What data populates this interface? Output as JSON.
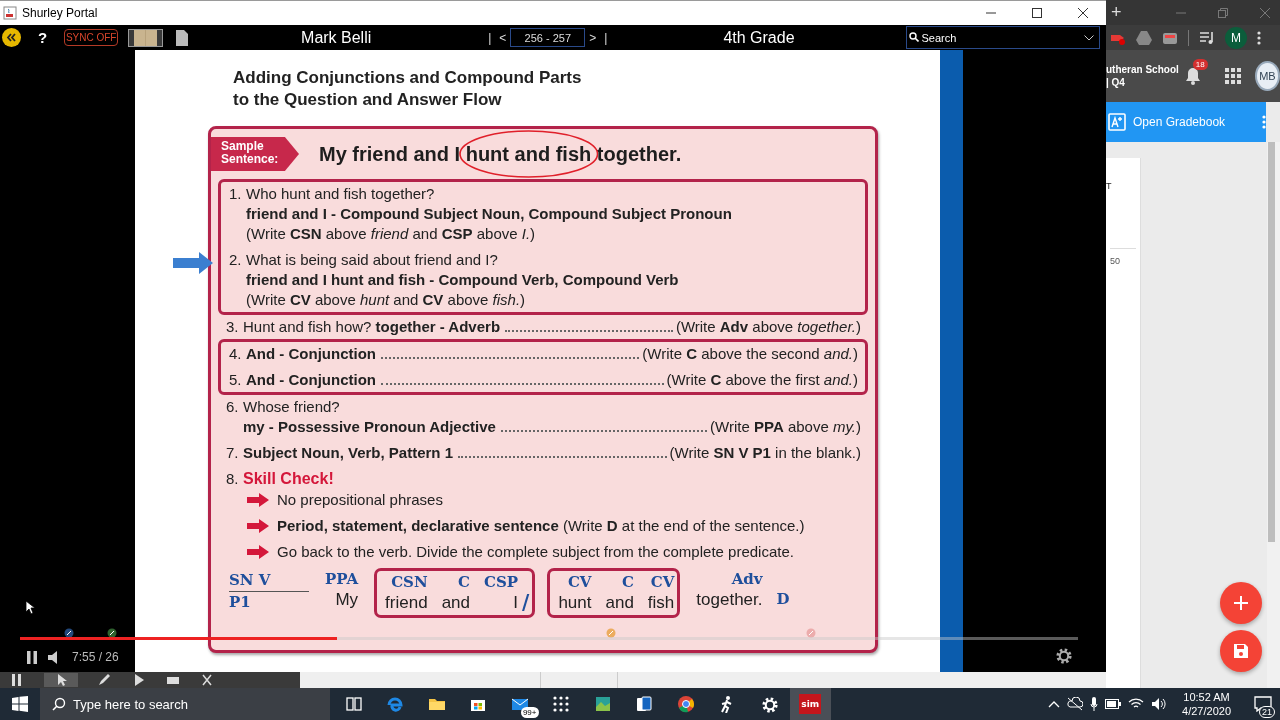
{
  "window": {
    "title": "Shurley Portal"
  },
  "toolbar": {
    "help": "?",
    "sync": "SYNC OFF",
    "teacher": "Mark Belli",
    "first": "|",
    "prev": "<",
    "pages": "256 - 257",
    "next": ">",
    "last": "|",
    "grade": "4th Grade",
    "search": {
      "placeholder": "Search"
    }
  },
  "lesson": {
    "title": [
      "Adding Conjunctions and Compound Parts",
      "to the Question and Answer Flow"
    ],
    "sample": {
      "label": "Sample Sentence:",
      "before": "My friend and I ",
      "circled": "hunt and fish",
      "after": " together."
    },
    "groups": [
      {
        "boxed": true,
        "steps": [
          {
            "kind": "qa",
            "num": "1.",
            "pointer": false,
            "lines": [
              {
                "text": "Who hunt and fish together?",
                "bold": false
              },
              {
                "text": "friend and I -  Compound Subject Noun, Compound Subject Pronoun",
                "bold": true
              },
              {
                "text": "(Write **CSN** above *friend* and **CSP** above *I.*)",
                "bold": false
              }
            ]
          },
          {
            "kind": "qa",
            "num": "2.",
            "pointer": true,
            "lines": [
              {
                "text": "What is being said about friend and I?",
                "bold": false
              },
              {
                "text": "friend and I hunt and fish - Compound Verb, Compound Verb",
                "bold": true
              },
              {
                "text": "(Write **CV** above *hunt* and **CV** above *fish.*)",
                "bold": false
              }
            ]
          }
        ]
      },
      {
        "boxed": false,
        "steps": [
          {
            "kind": "qa",
            "num": "3.",
            "pointer": false,
            "lines": [
              {
                "text": "Hunt and fish how?  **together - Adverb**",
                "bold": false,
                "note": "(Write **Adv** above *together.*)"
              }
            ]
          }
        ]
      },
      {
        "boxed": true,
        "steps": [
          {
            "kind": "qa",
            "num": "4.",
            "pointer": false,
            "lines": [
              {
                "text": "And - Conjunction",
                "bold": true,
                "note": "(Write **C** above the second *and.*)"
              }
            ]
          },
          {
            "kind": "qa",
            "num": "5.",
            "pointer": false,
            "lines": [
              {
                "text": "And - Conjunction",
                "bold": true,
                "note": "(Write **C** above the first *and.*)"
              }
            ]
          }
        ]
      },
      {
        "boxed": false,
        "steps": [
          {
            "kind": "qa",
            "num": "6.",
            "pointer": false,
            "lines": [
              {
                "text": "Whose friend?",
                "bold": false
              },
              {
                "text": "my - Possessive Pronoun Adjective",
                "bold": true,
                "note": "(Write **PPA** above *my.*)"
              }
            ]
          },
          {
            "kind": "qa",
            "num": "7.",
            "pointer": false,
            "lines": [
              {
                "text": "Subject Noun, Verb, Pattern 1",
                "bold": true,
                "note": "(Write **SN V P1** in the blank.)"
              }
            ]
          },
          {
            "kind": "check",
            "num": "8.",
            "pointer": false,
            "heading": "Skill Check!",
            "bullets": [
              {
                "text": "No prepositional phrases",
                "bold": false
              },
              {
                "text": "**Period, statement, declarative sentence** (Write **D** at the end of the sentence.)",
                "bold": false
              },
              {
                "text": "Go back to the verb. Divide the complete subject from the complete predicate.",
                "bold": false
              }
            ]
          }
        ]
      }
    ],
    "diagram": {
      "blank": [
        "SN V",
        "P1"
      ],
      "groups": [
        {
          "boxed": false,
          "tokens": [
            {
              "kind": "word",
              "label": "PPA",
              "word": "My"
            }
          ]
        },
        {
          "boxed": true,
          "tokens": [
            {
              "kind": "word",
              "label": "CSN",
              "word": "friend"
            },
            {
              "kind": "word",
              "label": "C",
              "word": "and"
            },
            {
              "kind": "word",
              "label": "CSP",
              "word": "I"
            },
            {
              "kind": "slash",
              "text": "/"
            }
          ]
        },
        {
          "boxed": true,
          "tokens": [
            {
              "kind": "word",
              "label": "CV",
              "word": "hunt"
            },
            {
              "kind": "word",
              "label": "C",
              "word": "and"
            },
            {
              "kind": "word",
              "label": "CV",
              "word": "fish"
            }
          ]
        },
        {
          "boxed": false,
          "tokens": [
            {
              "kind": "word",
              "label": "Adv",
              "word": "together."
            },
            {
              "kind": "end",
              "text": "D"
            }
          ]
        }
      ]
    }
  },
  "video": {
    "progress": {
      "level": 0.3
    },
    "time": "7:55 / 26"
  },
  "browser": {
    "new_tab": "+",
    "account": "M",
    "school": "utheran School",
    "term": "| Q4",
    "notifications": "18",
    "avatar": "MB",
    "action": "Open Gradebook",
    "card": [
      "T",
      "50"
    ]
  },
  "taskbar": {
    "search": {
      "placeholder": "Type here to search"
    },
    "apps": [
      {
        "kind": "taskview",
        "selected": false
      },
      {
        "kind": "edge",
        "selected": false
      },
      {
        "kind": "folder",
        "selected": false
      },
      {
        "kind": "store",
        "selected": false
      },
      {
        "kind": "mail",
        "selected": false,
        "badge": "99+"
      },
      {
        "kind": "dialpad",
        "selected": false
      },
      {
        "kind": "photo",
        "selected": false
      },
      {
        "kind": "cards",
        "selected": false
      },
      {
        "kind": "globe",
        "selected": false
      },
      {
        "kind": "runner",
        "selected": false
      },
      {
        "kind": "settings",
        "selected": false
      },
      {
        "kind": "logo",
        "selected": true,
        "label": "sim"
      }
    ],
    "time": "10:52 AM",
    "date": "4/27/2020",
    "notifications": "21"
  }
}
